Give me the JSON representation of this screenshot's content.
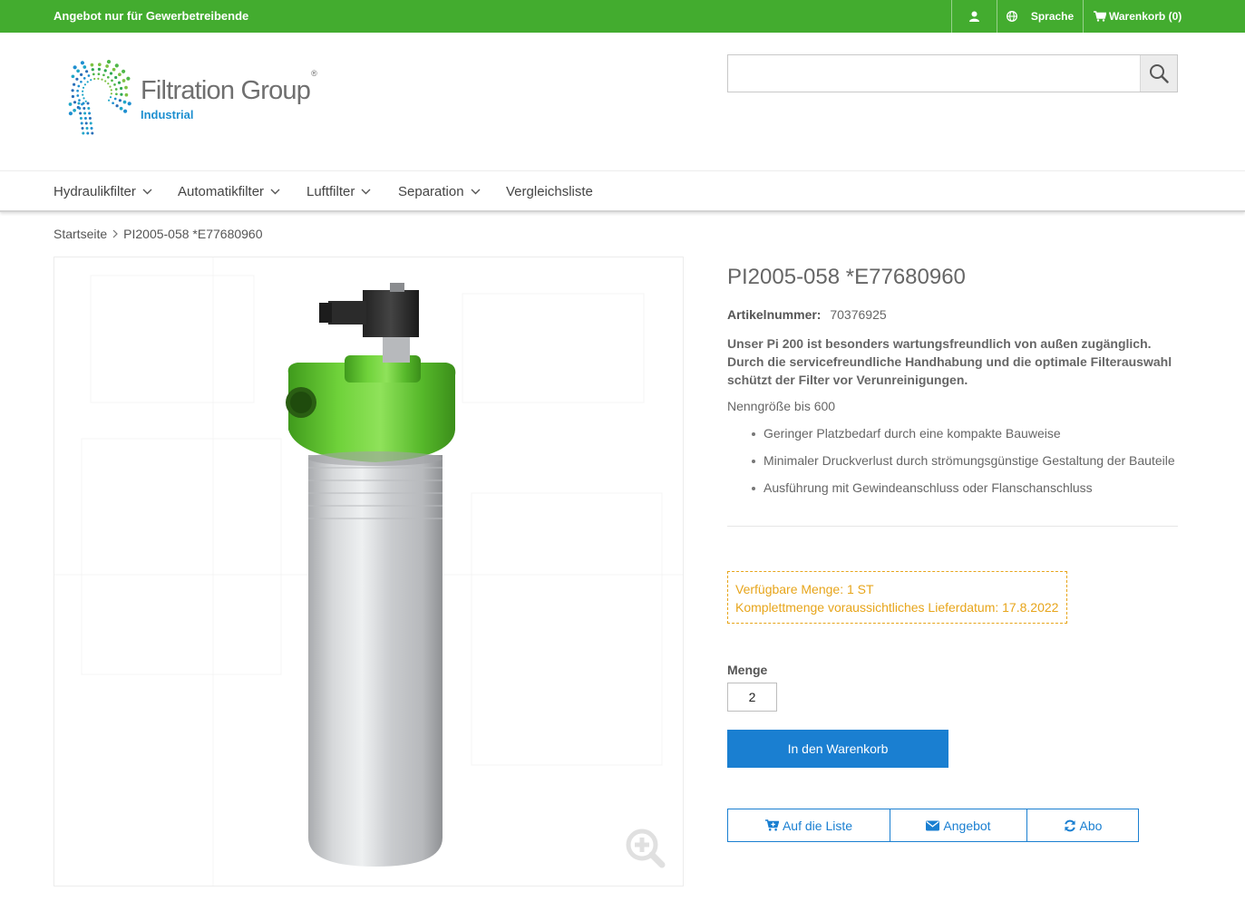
{
  "topbar": {
    "promo": "Angebot nur für Gewerbetreibende",
    "language_label": "Sprache",
    "cart_label": "Warenkorb (0)"
  },
  "logo": {
    "name": "Filtration Group",
    "registered": "®",
    "subtitle": "Industrial"
  },
  "search": {
    "placeholder": "",
    "value": ""
  },
  "nav": {
    "items": [
      {
        "label": "Hydraulikfilter",
        "dropdown": true
      },
      {
        "label": "Automatikfilter",
        "dropdown": true
      },
      {
        "label": "Luftfilter",
        "dropdown": true
      },
      {
        "label": "Separation",
        "dropdown": true
      },
      {
        "label": "Vergleichsliste",
        "dropdown": false
      }
    ]
  },
  "breadcrumb": {
    "home": "Startseite",
    "current": "PI2005-058 *E77680960"
  },
  "product": {
    "title": "PI2005-058 *E77680960",
    "article_label": "Artikelnummer:",
    "article_number": "70376925",
    "description": "Unser Pi 200 ist besonders wartungsfreundlich von außen zugänglich. Durch die servicefreundliche Handhabung und die optimale Filterauswahl schützt der Filter vor Verunreinigungen.",
    "size_text": "Nenngröße bis 600",
    "features": [
      "Geringer Platzbedarf durch eine kompakte Bauweise",
      "Minimaler Druckverlust durch strömungsgünstige Gestaltung der Bauteile",
      "Ausführung mit Gewindeanschluss oder Flanschanschluss"
    ]
  },
  "availability": {
    "line1": "Verfügbare Menge: 1 ST",
    "line2": "Komplettmenge voraussichtliches Lieferdatum: 17.8.2022"
  },
  "quantity": {
    "label": "Menge",
    "value": "2"
  },
  "buttons": {
    "add_to_cart": "In den Warenkorb",
    "to_list": "Auf die Liste",
    "quote": "Angebot",
    "subscription": "Abo"
  },
  "colors": {
    "brand_green": "#43ac2f",
    "primary_blue": "#1a7fd1",
    "availability_orange": "#e7a51b",
    "filter_head_green": "#5fc92e"
  }
}
